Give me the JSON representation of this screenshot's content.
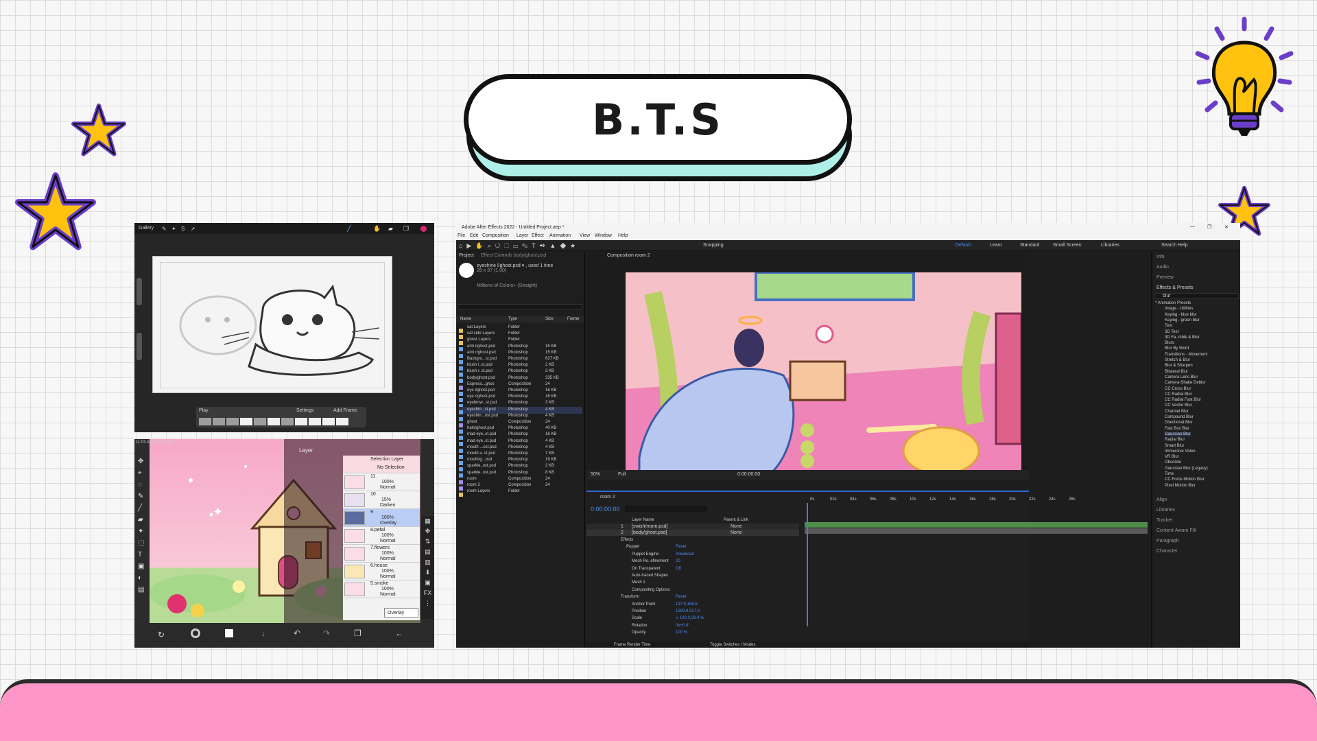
{
  "title": "B.T.S",
  "colors": {
    "accent_pink": "#ff96c8",
    "accent_teal": "#aef0e8",
    "star_yellow": "#ffc20e",
    "star_outline": "#6a3ec9"
  },
  "procreate_top": {
    "gallery": "Gallery",
    "play": "Play",
    "settings": "Settings",
    "add_frame": "Add Frame"
  },
  "ibis": {
    "status": "11:03 AM  Wed 5 Apr",
    "panel_title": "Layer",
    "selection_layer": "Selection Layer",
    "no_selection": "No Selection",
    "layers": [
      {
        "name": "11",
        "opacity": "100%",
        "mode": "Normal"
      },
      {
        "name": "10",
        "opacity": "15%",
        "mode": "Darken"
      },
      {
        "name": "9",
        "opacity": "100%",
        "mode": "Overlay"
      },
      {
        "name": "8.petal",
        "opacity": "100%",
        "mode": "Normal"
      },
      {
        "name": "7.flowers",
        "opacity": "100%",
        "mode": "Normal"
      },
      {
        "name": "6.house",
        "opacity": "100%",
        "mode": "Normal"
      },
      {
        "name": "5.smoke",
        "opacity": "100%",
        "mode": "Normal"
      }
    ],
    "blend_mode": "Overlay"
  },
  "ae": {
    "window_title": "Adobe After Effects 2022 - Untitled Project.aep *",
    "menu": [
      "File",
      "Edit",
      "Composition",
      "Layer",
      "Effect",
      "Animation",
      "View",
      "Window",
      "Help"
    ],
    "workspaces": [
      "Default",
      "Learn",
      "Standard",
      "Small Screen",
      "Libraries"
    ],
    "search_help": "Search Help",
    "snapping": "Snapping",
    "project_tab": "Project",
    "effect_controls": "Effect Controls body/ghost.psd",
    "composition_tab": "Composition room 2",
    "selected_item": "eyeshine l/ghost.psd ▾ , used 1 time",
    "selected_info": "28 x 37 (1.00)",
    "colors_info": "Millions of Colors+ (Straight)",
    "proj_headers": [
      "Name",
      "Type",
      "Size",
      "Frame"
    ],
    "project_items": [
      {
        "name": "cat Layers",
        "type": "Folder",
        "size": ""
      },
      {
        "name": "cat side Layers",
        "type": "Folder",
        "size": ""
      },
      {
        "name": "ghost Layers",
        "type": "Folder",
        "size": ""
      },
      {
        "name": "arm l/ghost.psd",
        "type": "Photoshop",
        "size": "15 KB"
      },
      {
        "name": "arm r/ghost.psd",
        "type": "Photoshop",
        "size": "15 KB"
      },
      {
        "name": "Backgro...st.psd",
        "type": "Photoshop",
        "size": "627 KB"
      },
      {
        "name": "blush l..st.psd",
        "type": "Photoshop",
        "size": "2 KB"
      },
      {
        "name": "blush r..st.psd",
        "type": "Photoshop",
        "size": "2 KB"
      },
      {
        "name": "body/ghost.psd",
        "type": "Photoshop",
        "size": "335 KB"
      },
      {
        "name": "Express...ghos",
        "type": "Composition",
        "size": "24"
      },
      {
        "name": "eye l/ghost.psd",
        "type": "Photoshop",
        "size": "16 KB"
      },
      {
        "name": "eye r/ghost.psd",
        "type": "Photoshop",
        "size": "16 KB"
      },
      {
        "name": "eyebrow...st.psd",
        "type": "Photoshop",
        "size": "3 KB"
      },
      {
        "name": "eyeshin...st.psd",
        "type": "Photoshop",
        "size": "4 KB"
      },
      {
        "name": "eyeshin...ost.psd",
        "type": "Photoshop",
        "size": "4 KB"
      },
      {
        "name": "ghost",
        "type": "Composition",
        "size": "24"
      },
      {
        "name": "halo/ghost.psd",
        "type": "Photoshop",
        "size": "40 KB"
      },
      {
        "name": "mad eye..st.psd",
        "type": "Photoshop",
        "size": "16 KB"
      },
      {
        "name": "mad eye..st.psd",
        "type": "Photoshop",
        "size": "4 KB"
      },
      {
        "name": "mouth ...ost.psd",
        "type": "Photoshop",
        "size": "4 KB"
      },
      {
        "name": "mouth u..st.psd",
        "type": "Photoshop",
        "size": "7 KB"
      },
      {
        "name": "mouth/g...psd",
        "type": "Photoshop",
        "size": "19 KB"
      },
      {
        "name": "sparkle..ost.psd",
        "type": "Photoshop",
        "size": "3 KB"
      },
      {
        "name": "sparkle..ost.psd",
        "type": "Photoshop",
        "size": "8 KB"
      },
      {
        "name": "room",
        "type": "Composition",
        "size": "24"
      },
      {
        "name": "room 2",
        "type": "Composition",
        "size": "24"
      },
      {
        "name": "room Layers",
        "type": "Folder",
        "size": ""
      }
    ],
    "viewer_zoom": "50%",
    "viewer_res": "Full",
    "viewer_time": "0:00:00:00",
    "timeline_tab": "room 2",
    "timecode": "0:00:00:00",
    "ruler": [
      "0s",
      "02s",
      "04s",
      "06s",
      "08s",
      "10s",
      "12s",
      "14s",
      "16s",
      "18s",
      "20s",
      "22s",
      "24s",
      "26s"
    ],
    "layers": [
      {
        "num": "1",
        "name": "[swish/room.psd]"
      },
      {
        "num": "2",
        "name": "[body/ghost.psd]"
      }
    ],
    "layer_header": "Layer Name",
    "parent_header": "Parent & Link",
    "parent_none": "None",
    "props": [
      {
        "name": "Effects",
        "value": ""
      },
      {
        "name": "Puppet",
        "value": "Reset"
      },
      {
        "name": "Puppet Engine",
        "value": "Advanced"
      },
      {
        "name": "Mesh Ro..efinement",
        "value": "20"
      },
      {
        "name": "On Transparent",
        "value": "Off"
      },
      {
        "name": "Auto-traced Shapes",
        "value": ""
      },
      {
        "name": "Mesh 1",
        "value": ""
      },
      {
        "name": "Compositing Options",
        "value": ""
      },
      {
        "name": "Transform",
        "value": "Reset"
      },
      {
        "name": "Anchor Point",
        "value": "127.5,168.5"
      },
      {
        "name": "Position",
        "value": "1293.9,917.0"
      },
      {
        "name": "Scale",
        "value": "∞ 100.0,29.4 %"
      },
      {
        "name": "Rotation",
        "value": "0x+0.0°"
      },
      {
        "name": "Opacity",
        "value": "100 %"
      }
    ],
    "footer": "Frame Render Time",
    "footer_switch": "Toggle Switches / Modes",
    "right_tabs": [
      "Info",
      "Audio",
      "Preview",
      "Effects & Presets"
    ],
    "right_search": "blur",
    "effects_tree": [
      "* Animation Presets",
      "Image - Utilities",
      "Keying - blue blur",
      "Keying - green blur",
      "Text",
      "3D Text",
      "3D Fa..mble & Blur",
      "Blurs",
      "Blur By Word",
      "Transitions - Movement",
      "Stretch & Blur",
      "Blur & Sharpen",
      "Bilateral Blur",
      "Camera Lens Blur",
      "Camera-Shake Deblur",
      "CC Cross Blur",
      "CC Radial Blur",
      "CC Radial Fast Blur",
      "CC Vector Blur",
      "Channel Blur",
      "Compound Blur",
      "Directional Blur",
      "Fast Box Blur",
      "Gaussian Blur",
      "Radial Blur",
      "Smart Blur",
      "Immersive Video",
      "VR Blur",
      "Obsolete",
      "Gaussian Blur (Legacy)",
      "Time",
      "CC Force Motion Blur",
      "Pixel Motion Blur"
    ],
    "right_bottom": [
      "Align",
      "Libraries",
      "Tracker",
      "Content-Aware Fill",
      "Paragraph",
      "Character"
    ]
  }
}
